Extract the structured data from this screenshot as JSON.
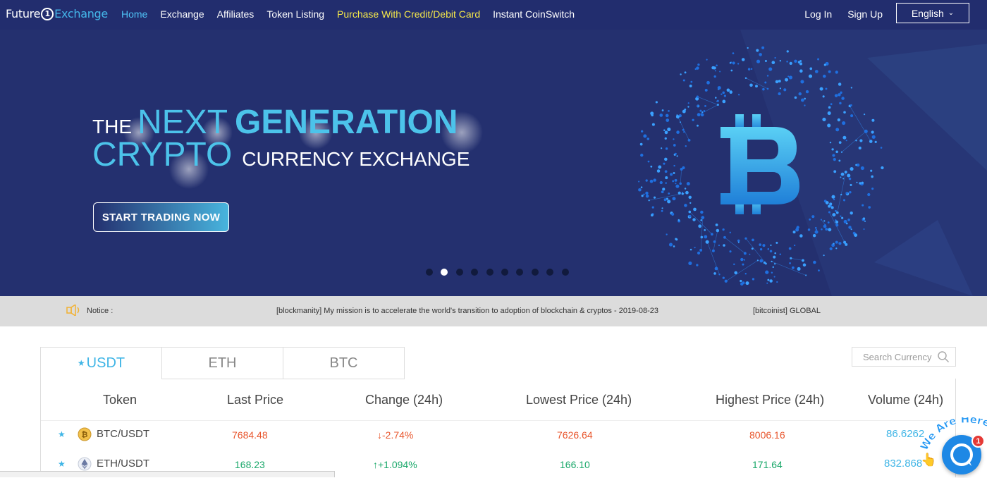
{
  "nav": {
    "logo_part1": "Future",
    "logo_num": "1",
    "logo_part2": "Exchange",
    "links": [
      "Home",
      "Exchange",
      "Affiliates",
      "Token Listing",
      "Purchase With Credit/Debit Card",
      "Instant CoinSwitch"
    ],
    "login": "Log In",
    "signup": "Sign Up",
    "language": "English"
  },
  "hero": {
    "word_the": "THE",
    "word_next": "NEXT",
    "word_generation": "GENERATION",
    "word_crypto": "CRYPTO",
    "word_currency_exchange": "CURRENCY EXCHANGE",
    "cta": "START TRADING NOW",
    "slide_count": 10,
    "active_slide": 2
  },
  "notice": {
    "label": "Notice :",
    "item1": "[blockmanity] My mission is to accelerate the world's transition to adoption of blockchain & cryptos  -  2019-08-23",
    "item2": "[bitcoinist] GLOBAL"
  },
  "market": {
    "tabs": [
      "USDT",
      "ETH",
      "BTC"
    ],
    "active_tab": "USDT",
    "search_placeholder": "Search Currency",
    "columns": [
      "Token",
      "Last Price",
      "Change (24h)",
      "Lowest Price (24h)",
      "Highest Price (24h)",
      "Volume (24h)"
    ],
    "rows": [
      {
        "pair": "BTC/USDT",
        "last": "7684.48",
        "change": "-2.74%",
        "low": "7626.64",
        "high": "8006.16",
        "volume": "86.6262"
      },
      {
        "pair": "ETH/USDT",
        "last": "168.23",
        "change": "+1.094%",
        "low": "166.10",
        "high": "171.64",
        "volume": "832.868"
      }
    ]
  },
  "chat": {
    "label": "We Are Here!",
    "badge": "1"
  },
  "colors": {
    "nav_bg": "#222d6e",
    "hero_bg": "#24306f",
    "accent": "#4cc3ea",
    "promo": "#f5e84a",
    "down": "#e8562d",
    "up": "#1aa86a"
  }
}
